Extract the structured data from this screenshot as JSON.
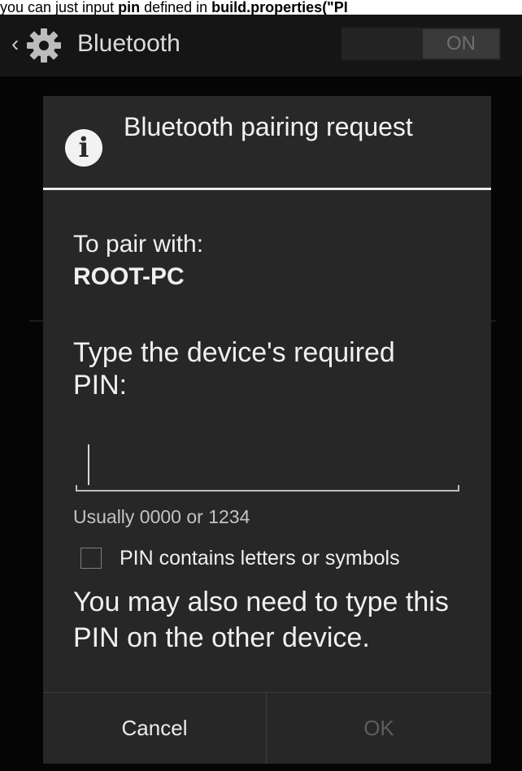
{
  "caption": {
    "prefix": "you can just input ",
    "bold1": "pin",
    "middle": " defined in ",
    "bold2": "build.properties",
    "suffix": "(\"PI"
  },
  "actionbar": {
    "up_glyph": "‹",
    "icon": "gear-icon",
    "title": "Bluetooth",
    "toggle_state": "ON"
  },
  "dialog": {
    "icon": "info-icon",
    "icon_glyph": "i",
    "title": "Bluetooth pairing request",
    "pair_label": "To pair with:",
    "device_name": "ROOT-PC",
    "pin_prompt": "Type the device's required PIN:",
    "pin_value": "",
    "hint": "Usually 0000 or 1234",
    "checkbox_label": "PIN contains letters or symbols",
    "checkbox_checked": false,
    "note": "You may also need to type this PIN on the other device.",
    "cancel_label": "Cancel",
    "ok_label": "OK"
  },
  "colors": {
    "background": "#000000",
    "dialog": "#272727",
    "text": "#f0f0f0",
    "disabled": "#5d5d5d"
  }
}
